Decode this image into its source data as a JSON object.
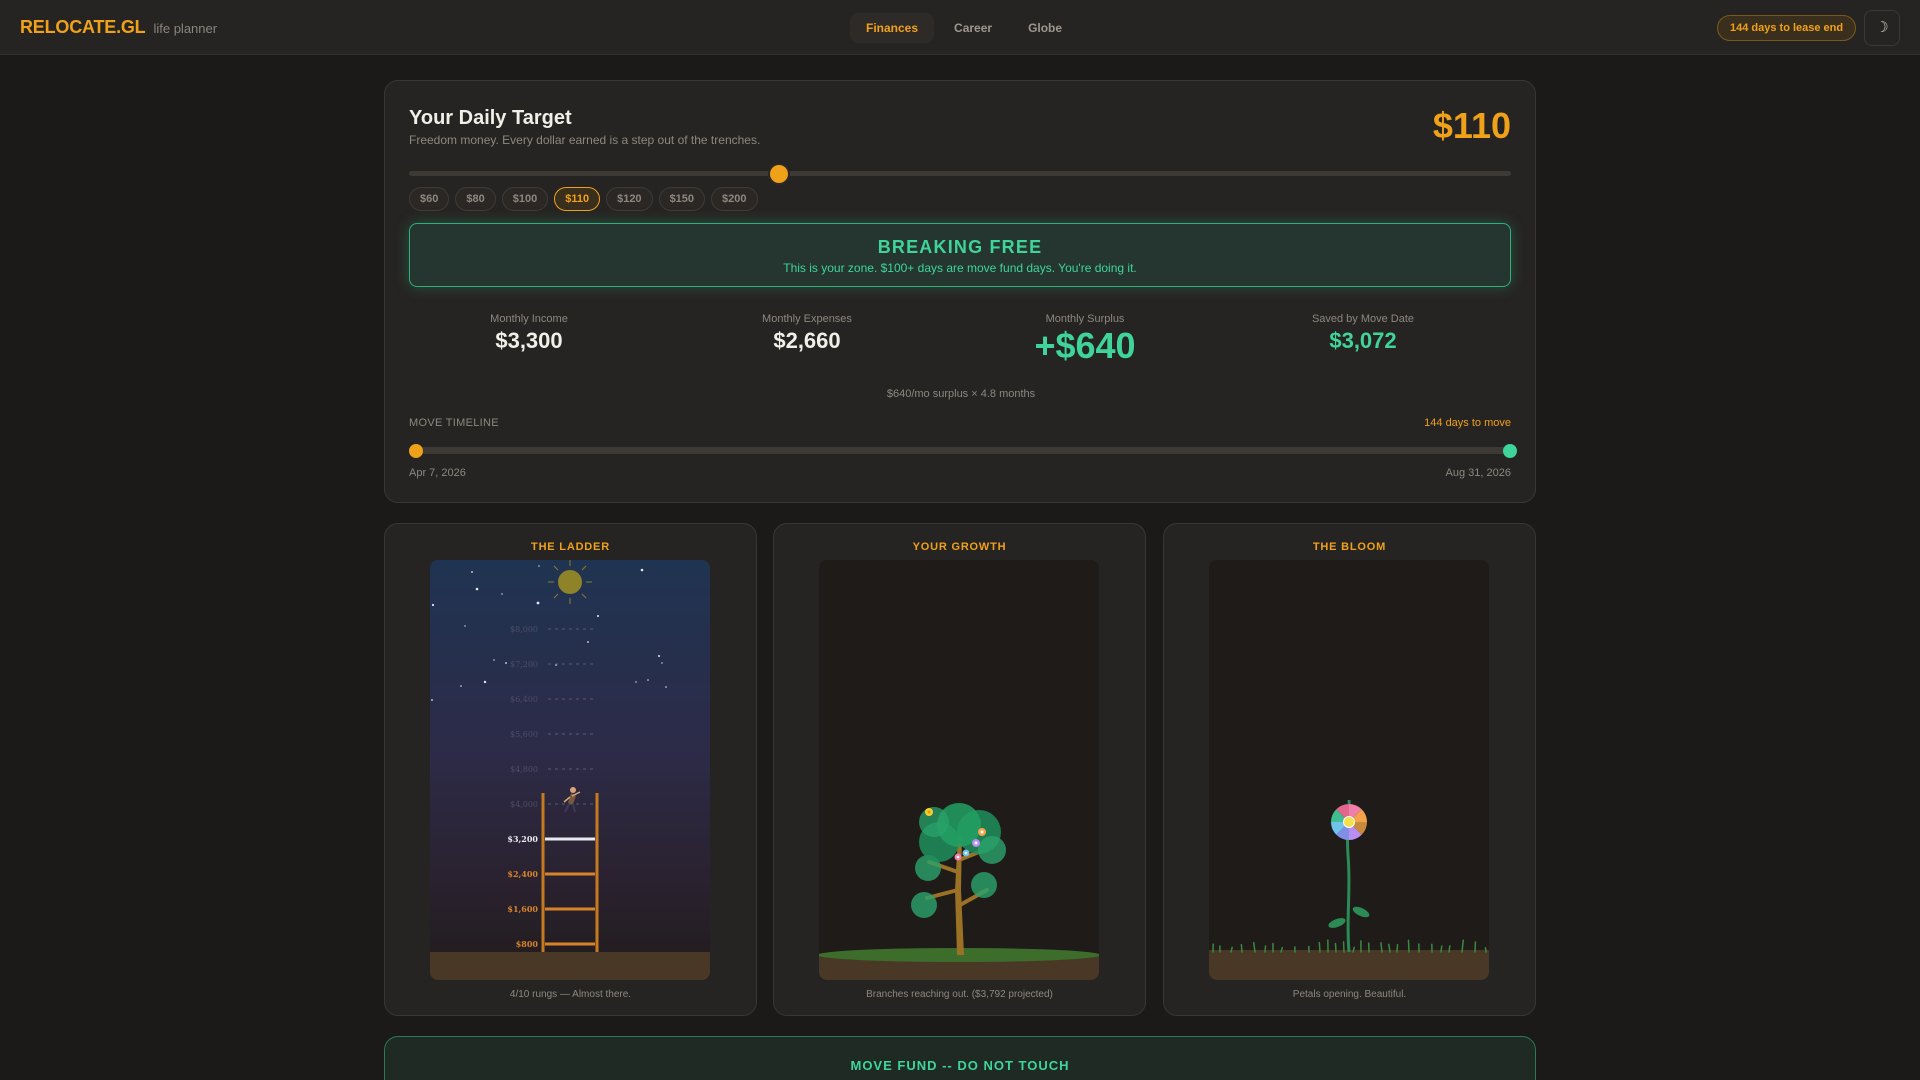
{
  "app": {
    "logo": "RELOCATE.GL",
    "subtitle": "life planner"
  },
  "nav": {
    "tabs": [
      "Finances",
      "Career",
      "Globe"
    ],
    "active": "Finances"
  },
  "header": {
    "lease_countdown": "144 days to lease end",
    "theme_icon": "moon-icon",
    "theme_glyph": "☽"
  },
  "daily_target": {
    "title": "Your Daily Target",
    "subtitle": "Freedom money. Every dollar earned is a step out of the trenches.",
    "value": "$110",
    "slider_level": 0.333,
    "presets": [
      "$60",
      "$80",
      "$100",
      "$110",
      "$120",
      "$150",
      "$200"
    ],
    "selected_preset": "$110"
  },
  "zone": {
    "title": "BREAKING FREE",
    "message": "This is your zone. $100+ days are move fund days. You're doing it."
  },
  "stats": {
    "income": {
      "label": "Monthly Income",
      "value": "$3,300"
    },
    "expenses": {
      "label": "Monthly Expenses",
      "value": "$2,660"
    },
    "surplus": {
      "label": "Monthly Surplus",
      "value": "+$640"
    },
    "saved": {
      "label": "Saved by Move Date",
      "value": "$3,072"
    },
    "note": "$640/mo surplus × 4.8 months"
  },
  "timeline": {
    "label": "MOVE TIMELINE",
    "days_to_move": "144 days to move",
    "start_date": "Apr 7, 2026",
    "end_date": "Aug 31, 2026"
  },
  "ladder": {
    "title": "THE LADDER",
    "caption": "4/10 rungs — Almost there.",
    "rungs": [
      "$800",
      "$1,600",
      "$2,400",
      "$3,200",
      "$4,000",
      "$4,800",
      "$5,600",
      "$6,400",
      "$7,200",
      "$8,000"
    ],
    "rungs_reached": 4
  },
  "growth": {
    "title": "YOUR GROWTH",
    "caption": "Branches reaching out. ($3,792 projected)"
  },
  "bloom": {
    "title": "THE BLOOM",
    "caption": "Petals opening. Beautiful."
  },
  "move_fund": {
    "title": "MOVE FUND -- DO NOT TOUCH"
  },
  "colors": {
    "accent": "#f0a11a",
    "success": "#3fd49a",
    "background": "#1c1a18",
    "card": "#262422"
  }
}
